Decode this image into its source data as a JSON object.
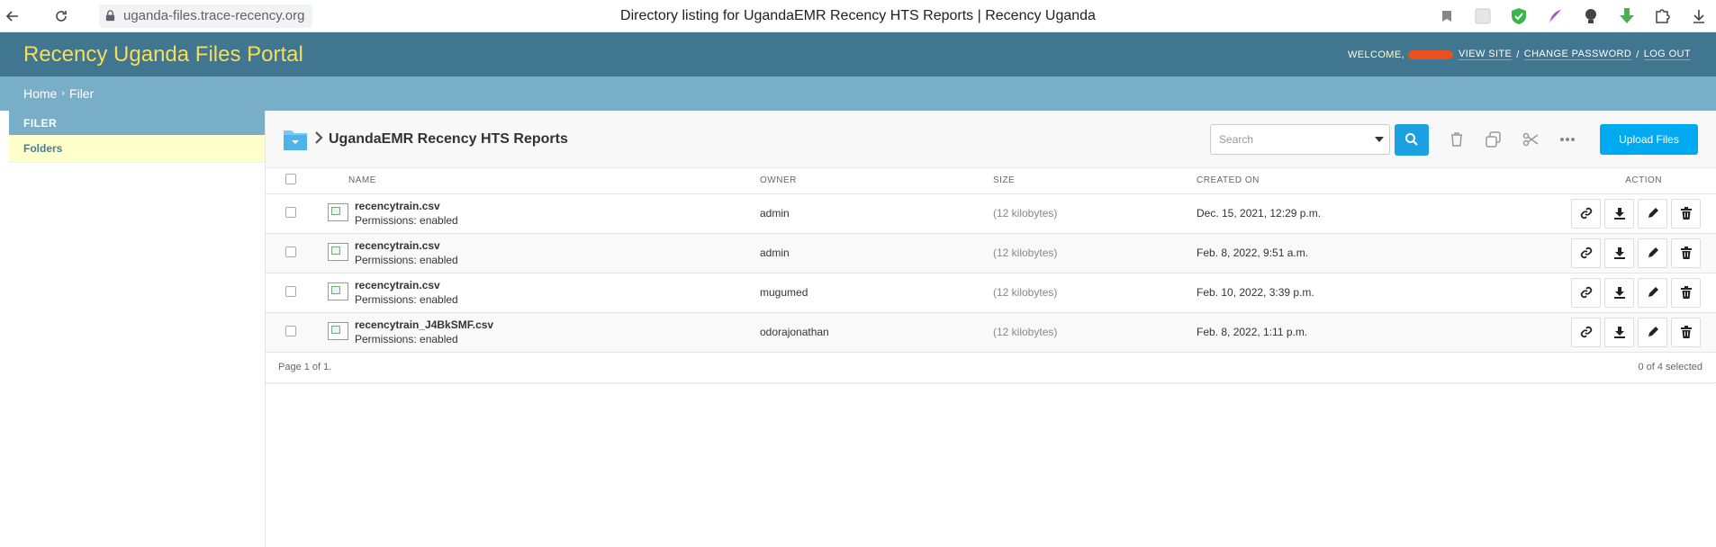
{
  "browser": {
    "url": "uganda-files.trace-recency.org",
    "tab_title": "Directory listing for UgandaEMR Recency HTS Reports | Recency Uganda"
  },
  "header": {
    "brand": "Recency Uganda Files Portal",
    "welcome": "WELCOME,",
    "view_site": "VIEW SITE",
    "change_password": "CHANGE PASSWORD",
    "log_out": "LOG OUT",
    "separator": "/"
  },
  "breadcrumbs": {
    "home": "Home",
    "separator": "›",
    "current": "Filer"
  },
  "sidebar": {
    "caption": "FILER",
    "items": [
      {
        "label": "Folders"
      }
    ]
  },
  "toolbar": {
    "folder_name": "UgandaEMR Recency HTS Reports",
    "search_placeholder": "Search",
    "upload_label": "Upload Files"
  },
  "table": {
    "headers": {
      "name": "NAME",
      "owner": "OWNER",
      "size": "SIZE",
      "created": "CREATED ON",
      "action": "ACTION"
    },
    "rows": [
      {
        "name": "recencytrain.csv",
        "perm": "Permissions: enabled",
        "owner": "admin",
        "size": "(12 kilobytes)",
        "created": "Dec. 15, 2021, 12:29 p.m."
      },
      {
        "name": "recencytrain.csv",
        "perm": "Permissions: enabled",
        "owner": "admin",
        "size": "(12 kilobytes)",
        "created": "Feb. 8, 2022, 9:51 a.m."
      },
      {
        "name": "recencytrain.csv",
        "perm": "Permissions: enabled",
        "owner": "mugumed",
        "size": "(12 kilobytes)",
        "created": "Feb. 10, 2022, 3:39 p.m."
      },
      {
        "name": "recencytrain_J4BkSMF.csv",
        "perm": "Permissions: enabled",
        "owner": "odorajonathan",
        "size": "(12 kilobytes)",
        "created": "Feb. 8, 2022, 1:11 p.m."
      }
    ]
  },
  "footer": {
    "pagination": "Page 1 of 1.",
    "selected": "0 of 4 selected"
  },
  "colors": {
    "header_bg": "#417690",
    "brand": "#f5dd5d",
    "breadcrumb_bg": "#79aec8",
    "accent": "#1ba1e2",
    "sidebar_row": "#ffffcc"
  }
}
